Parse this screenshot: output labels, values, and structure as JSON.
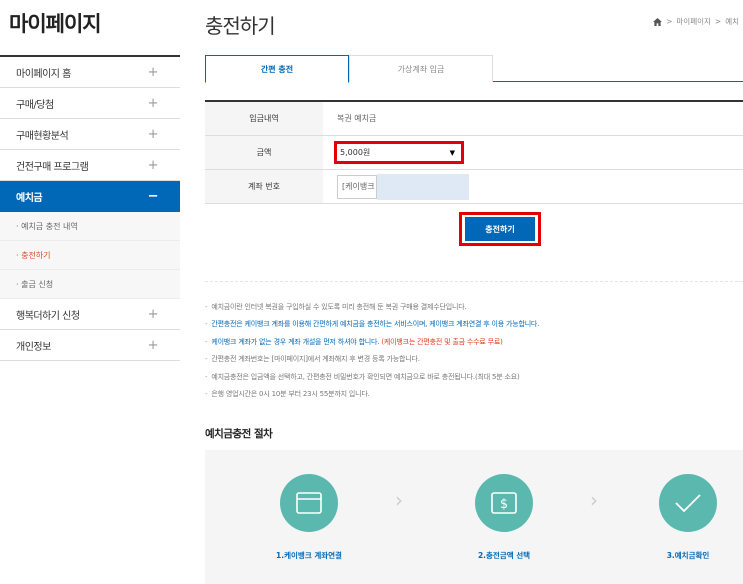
{
  "sidebar": {
    "title": "마이페이지",
    "items": [
      {
        "label": "마이페이지 홈",
        "icon": "+"
      },
      {
        "label": "구매/당첨",
        "icon": "+"
      },
      {
        "label": "구매현황분석",
        "icon": "+"
      },
      {
        "label": "건전구매 프로그램",
        "icon": "+"
      },
      {
        "label": "예치금",
        "icon": "−"
      },
      {
        "label": "행복더하기 신청",
        "icon": "+"
      },
      {
        "label": "개인정보",
        "icon": "+"
      }
    ],
    "sub_items": [
      {
        "label": "· 예치금 충전 내역"
      },
      {
        "label": "· 충전하기"
      },
      {
        "label": "· 출금 신청"
      }
    ]
  },
  "header": {
    "title": "충전하기",
    "breadcrumb": [
      "마이페이지",
      "예치"
    ],
    "breadcrumb_sep": ">"
  },
  "tabs": [
    {
      "label": "간편 충전"
    },
    {
      "label": "가상계좌 입금"
    }
  ],
  "form": {
    "rows": [
      {
        "label": "입금내역",
        "value": "복권 예치금"
      },
      {
        "label": "금액",
        "value": "5,000원"
      },
      {
        "label": "계좌 번호",
        "value": "[케이뱅크"
      }
    ]
  },
  "charge_button": "충전하기",
  "notices": [
    "예치금이란 인터넷 복권을 구입하실 수 있도록 미리 충전해 둔 복권 구매용 결제수단입니다.",
    "간편충전은 케이뱅크 계좌를 이용해 간편하게 예치금을 충전하는 서비스이며, 케이뱅크 계좌연결 후 이용 가능합니다.",
    "케이뱅크 계좌가 없는 경우 계좌 개설을 먼저 하셔야 합니다.",
    "(케이뱅크는 간편충전 및 출금 수수료 무료)",
    "간편충전 계좌번호는 [마이페이지]에서 계좌해지 후 변경 등록 가능합니다.",
    "예치금충전은 입금액을 선택하고, 간편충전 비밀번호가 확인되면 예치금으로 바로 충전됩니다.(최대 5분 소요)",
    "은행 영업시간은 0시 10분 부터 23시 55분까지 입니다."
  ],
  "notice_dash": "-",
  "process": {
    "title": "예치금충전 절차",
    "steps": [
      {
        "label": "1.케이뱅크 계좌연결",
        "icon": "card-icon"
      },
      {
        "label": "2.충전금액 선택",
        "icon": "money-icon"
      },
      {
        "label": "3.예치금확인",
        "icon": "check-icon"
      }
    ],
    "arrow": "›"
  },
  "colors": {
    "brand_blue": "#0068b7",
    "highlight_red": "#e30000",
    "teal": "#5bb8ae"
  }
}
